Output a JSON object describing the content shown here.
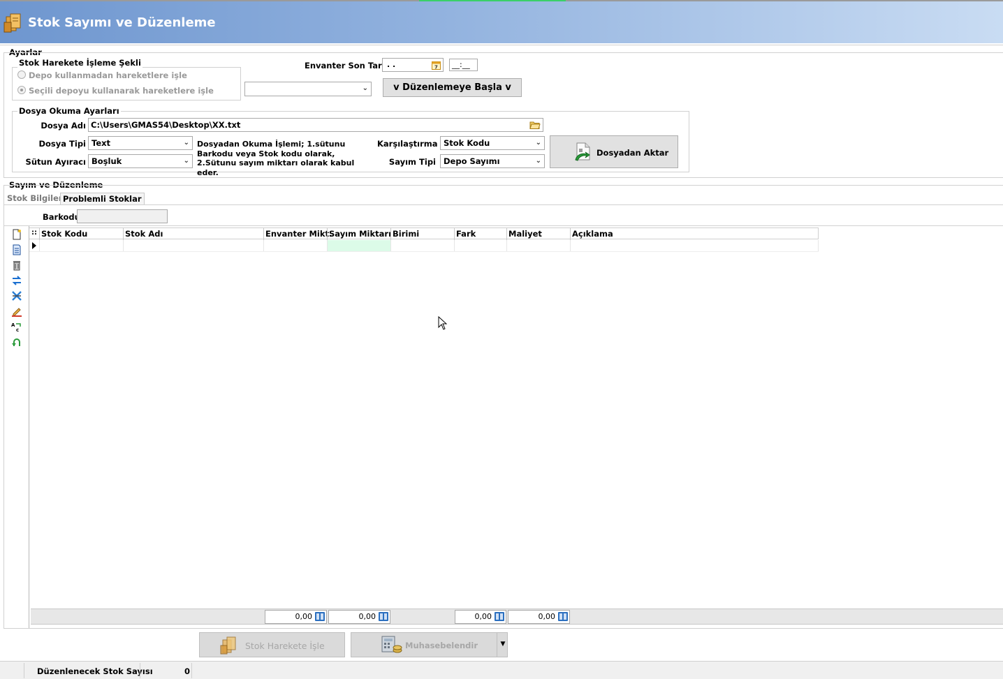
{
  "window": {
    "title": "Stok Sayımı ve Düzenleme"
  },
  "ayarlar": {
    "group_title": "Ayarlar",
    "stok_hareket": {
      "title": "Stok Harekete İşleme Şekli",
      "option1": "Depo kullanmadan hareketlere işle",
      "option2": "Seçili depoyu kullanarak hareketlere işle",
      "selected": 2
    },
    "envanter_label": "Envanter Son Tarih",
    "envanter_date": " . .",
    "envanter_time": "__:__",
    "depo_select": "",
    "start_button": "v Düzenlemeye Başla v"
  },
  "dosya": {
    "group_title": "Dosya Okuma Ayarları",
    "dosya_adi_label": "Dosya Adı",
    "dosya_adi_value": "C:\\Users\\GMAS54\\Desktop\\XX.txt",
    "dosya_tipi_label": "Dosya Tipi",
    "dosya_tipi_value": "Text",
    "sutun_label": "Sütun Ayıracı",
    "sutun_value": "Boşluk",
    "info_text": "Dosyadan Okuma İşlemi; 1.sütunu Barkodu veya Stok kodu olarak, 2.Sütunu sayım miktarı olarak kabul eder.",
    "karsilastirma_label": "Karşılaştırma",
    "karsilastirma_value": "Stok Kodu",
    "sayim_tipi_label": "Sayım Tipi",
    "sayim_tipi_value": "Depo Sayımı",
    "import_button": "Dosyadan Aktar"
  },
  "sayim": {
    "group_title": "Sayım ve Düzenleme",
    "tabs": [
      "Stok Bilgileri",
      "Problemli Stoklar"
    ],
    "barkod_label": "Barkodu",
    "barkod_value": "",
    "grid_columns": [
      "Stok Kodu",
      "Stok Adı",
      "Envanter Mikt.",
      "Sayım Miktarı",
      "Birimi",
      "Fark",
      "Maliyet",
      "Açıklama"
    ],
    "totals": [
      "0,00",
      "0,00",
      "0,00",
      "0,00"
    ],
    "toolbar_icons": [
      "new-icon",
      "document-icon",
      "delete-icon",
      "transfer-icon",
      "cancel-icon",
      "edit-icon",
      "replace-icon",
      "undo-icon"
    ]
  },
  "bottom": {
    "stok_harekete_button": "Stok Harekete İşle",
    "muhasebe_button": "Muhasebelendir",
    "status_label": "Düzenlenecek Stok Sayısı",
    "status_value": "0"
  },
  "colors": {
    "title_start": "#6e96cf",
    "title_end": "#c9dcf3",
    "sayim_cell": "#dcfbe8"
  }
}
